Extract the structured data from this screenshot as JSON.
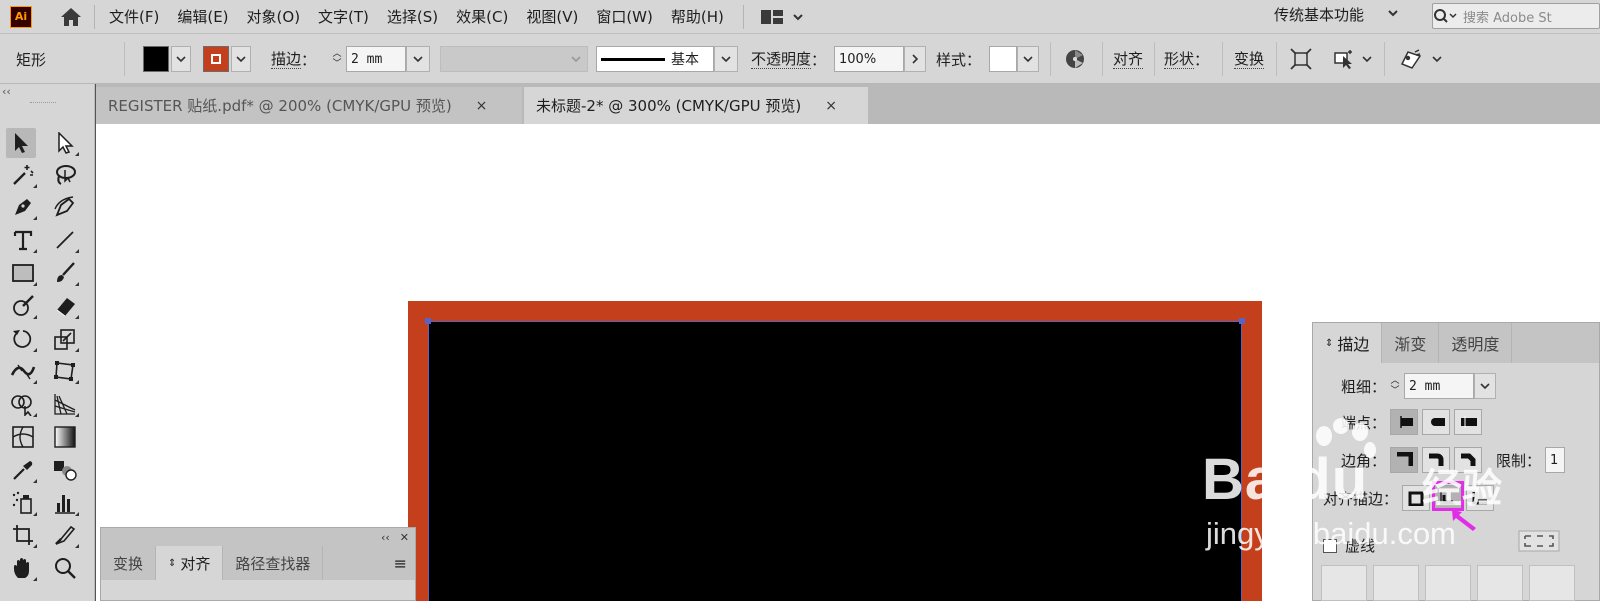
{
  "app": {
    "logo_text": "Ai",
    "brand_color": "#ff9a00",
    "menu": [
      "文件(F)",
      "编辑(E)",
      "对象(O)",
      "文字(T)",
      "选择(S)",
      "效果(C)",
      "视图(V)",
      "窗口(W)",
      "帮助(H)"
    ],
    "workspace": "传统基本功能",
    "search_placeholder": "搜索 Adobe St"
  },
  "control_bar": {
    "object_type": "矩形",
    "fill_color": "#000000",
    "stroke_color": "#c4401c",
    "stroke_label": "描边",
    "stroke_weight": "2 mm",
    "brush_label": "基本",
    "opacity_label": "不透明度",
    "opacity_value": "100%",
    "style_label": "样式",
    "align_label": "对齐",
    "shape_label": "形状",
    "transform_label": "变换",
    "colon": "："
  },
  "tabs": [
    {
      "title": "REGISTER 贴纸.pdf* @ 200% (CMYK/GPU 预览)",
      "active": false
    },
    {
      "title": "未标题-2* @ 300% (CMYK/GPU 预览)",
      "active": true
    }
  ],
  "tab_close": "×",
  "artwork": {
    "stroke_color": "#c4401c",
    "fill_color": "#000000",
    "selection_color": "#5a62c8"
  },
  "align_panel": {
    "tabs": [
      "变换",
      "对齐",
      "路径查找器"
    ],
    "active_tab": "对齐"
  },
  "stroke_panel": {
    "tabs": [
      "描边",
      "渐变",
      "透明度"
    ],
    "active_tab": "描边",
    "weight_label": "粗细：",
    "weight_value": "2 mm",
    "cap_label": "端点：",
    "corner_label": "边角：",
    "limit_label": "限制：",
    "limit_value": "1",
    "align_label": "对齐描边：",
    "dashed_label": "虚线"
  },
  "watermark": {
    "brand": "Bai",
    "brand_suffix": "du",
    "chinese": "经验",
    "url": "jingyan.baidu.com"
  },
  "highlight_color": "#e22ce8"
}
